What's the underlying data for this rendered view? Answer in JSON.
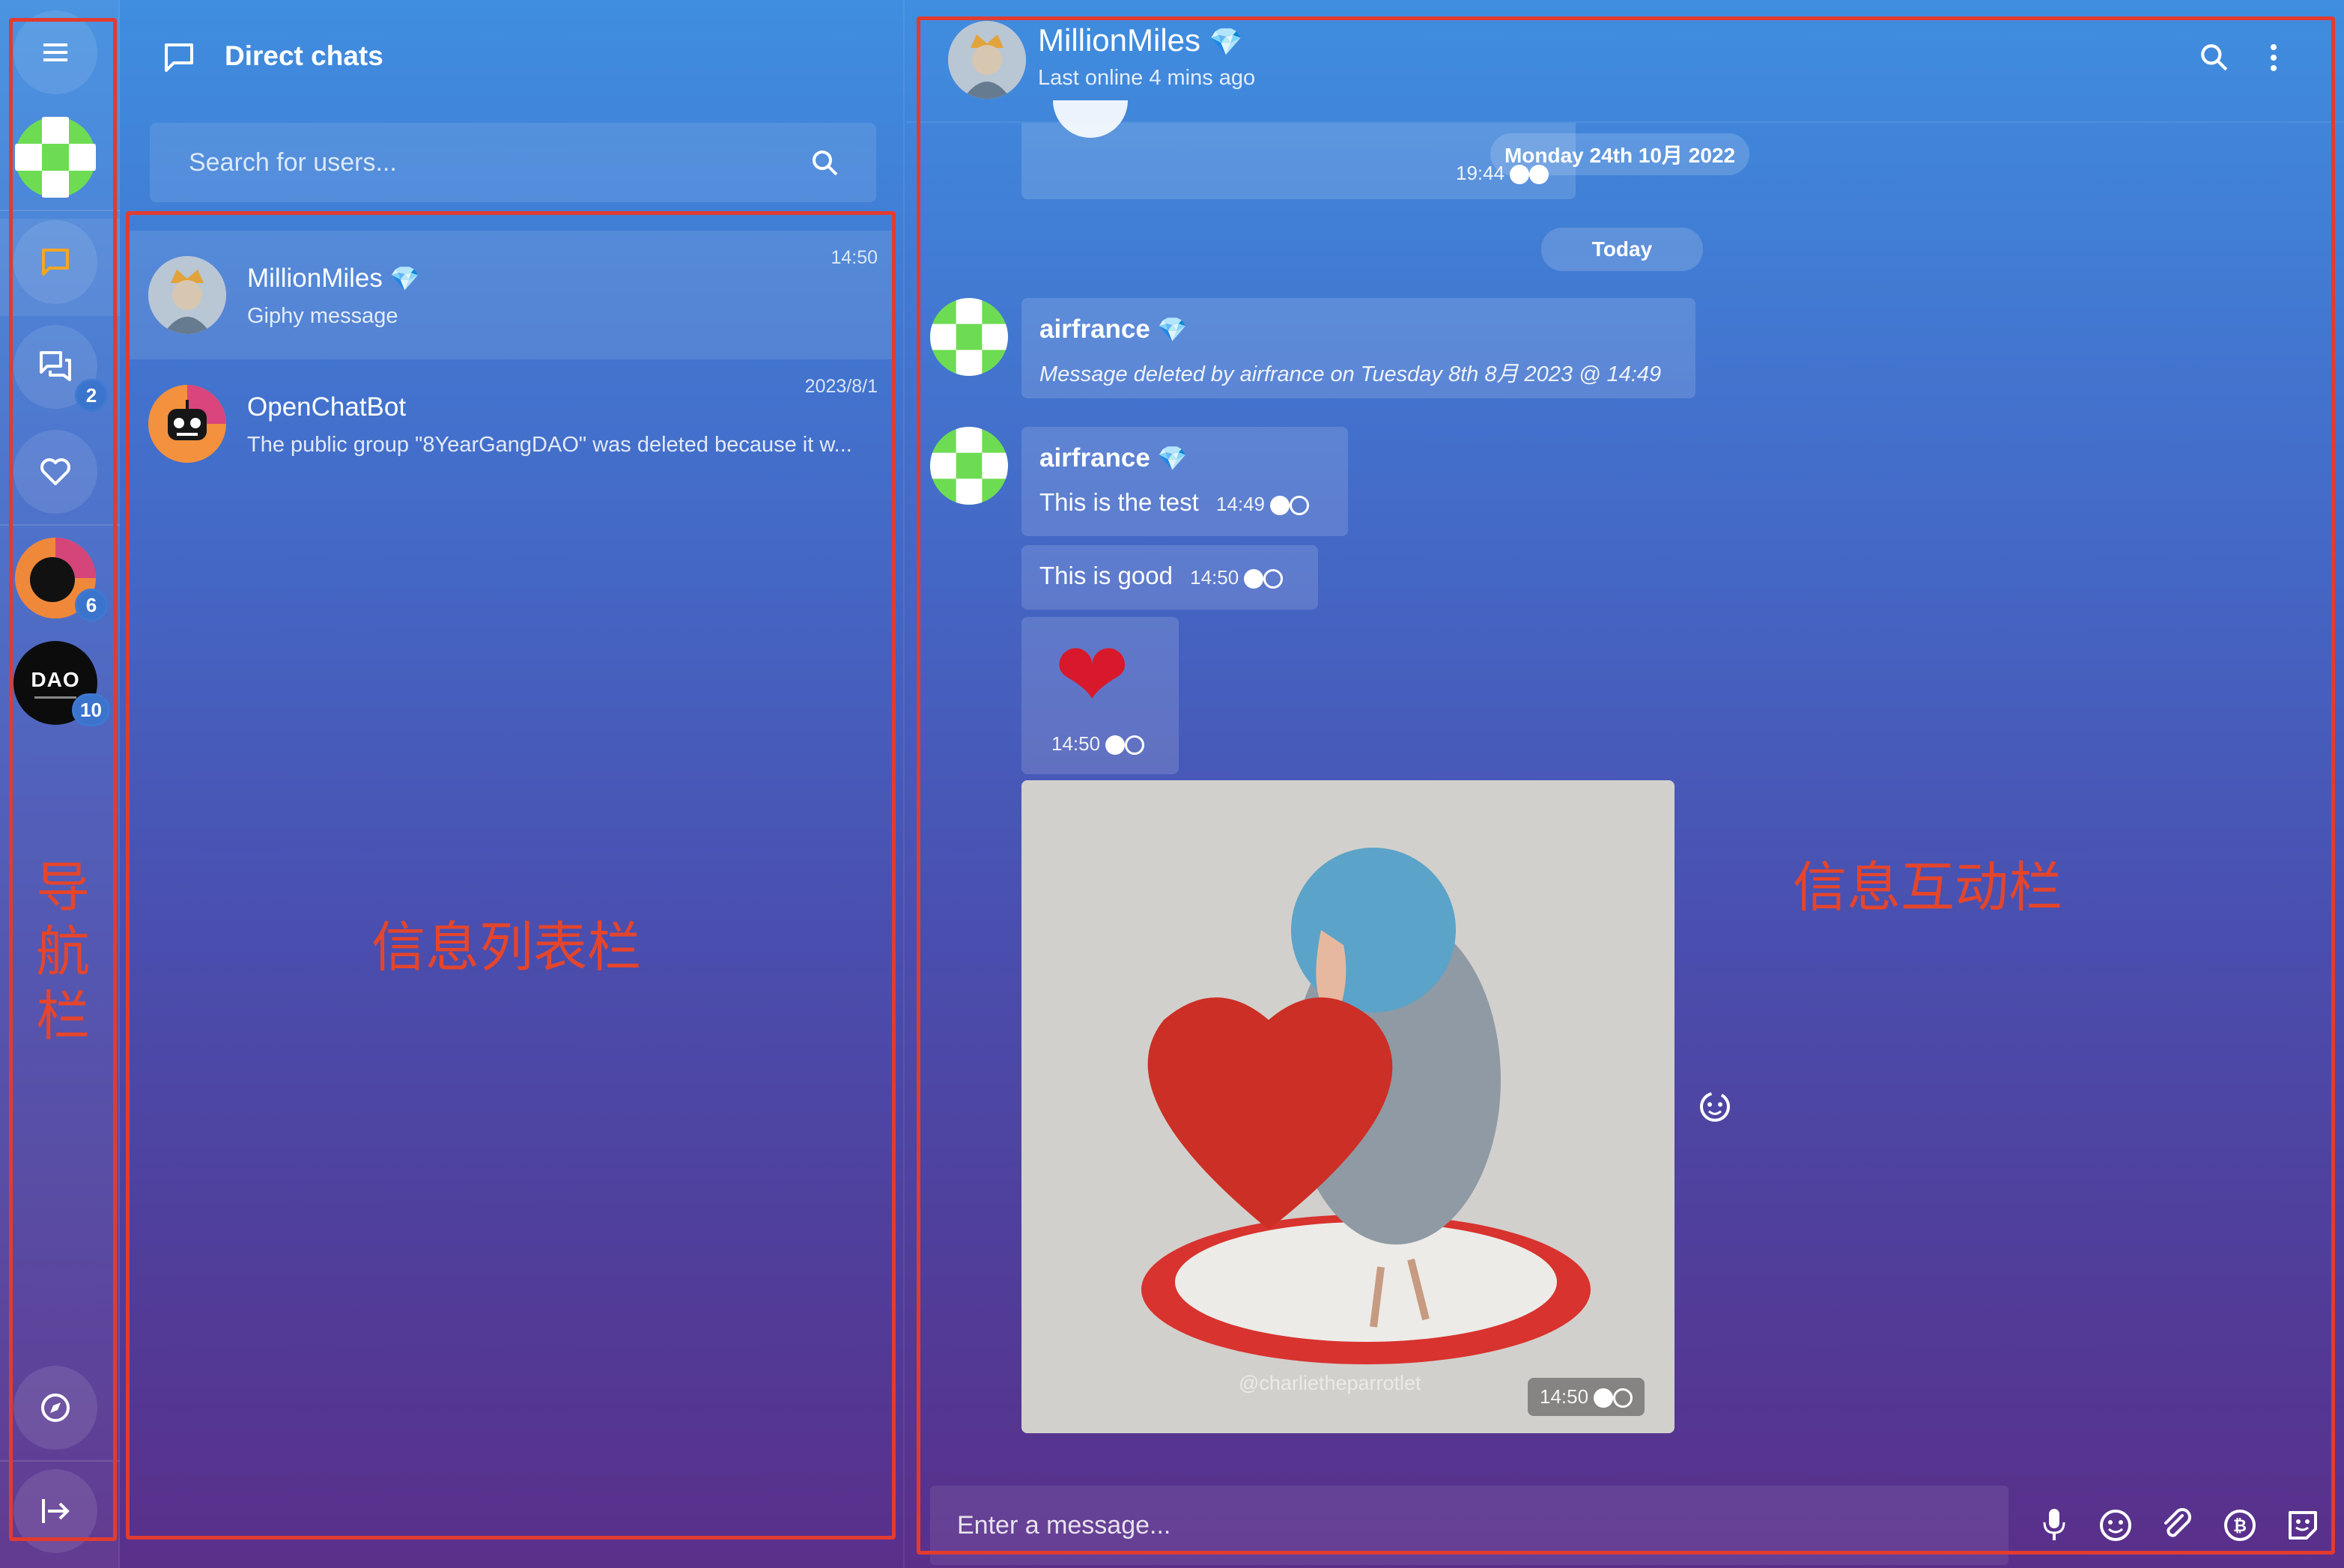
{
  "nav": {
    "badges": {
      "chats": "2",
      "community1": "6",
      "dao": "10"
    },
    "dao_logo": "DAO"
  },
  "list": {
    "title": "Direct chats",
    "search_placeholder": "Search for users...",
    "chats": [
      {
        "name": "MillionMiles",
        "preview": "Giphy message",
        "time": "14:50",
        "selected": true
      },
      {
        "name": "OpenChatBot",
        "preview": "The public group \"8YearGangDAO\" was deleted because it w...",
        "time": "2023/8/1",
        "selected": false
      }
    ]
  },
  "chat": {
    "name": "MillionMiles",
    "status": "Last online 4 mins ago",
    "date_prev": "Monday 24th 10月 2022",
    "time_prev": "19:44",
    "date_today": "Today",
    "messages": [
      {
        "sender": "airfrance",
        "text": "Message deleted by airfrance on Tuesday 8th 8月 2023 @ 14:49",
        "deleted": true
      },
      {
        "sender": "airfrance",
        "text": "This is the test",
        "time": "14:49"
      },
      {
        "text": "This is good",
        "time": "14:50"
      },
      {
        "emoji": "❤",
        "time": "14:50"
      },
      {
        "gif_watermark": "@charlietheparrotlet",
        "time": "14:50"
      }
    ],
    "composer_placeholder": "Enter a message..."
  },
  "annotations": {
    "nav": "导航栏",
    "list": "信息列表栏",
    "chat": "信息互动栏"
  },
  "colors": {
    "annotation_red": "#e23b2f",
    "bg_top": "#3f8ee0",
    "bg_bottom": "#5a2f8a"
  }
}
